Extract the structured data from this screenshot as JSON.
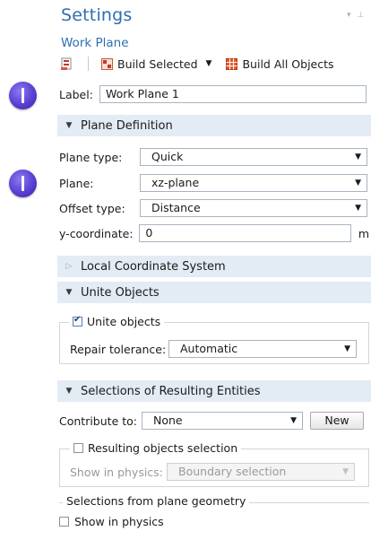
{
  "header": {
    "title": "Settings",
    "subtitle": "Work Plane",
    "pin_icon": "pin-icon"
  },
  "toolbar": {
    "build_selected_label": "Build Selected",
    "build_all_label": "Build All Objects",
    "icons": [
      "build-preceding-icon",
      "build-selected-icon",
      "build-all-icon"
    ]
  },
  "label_field": {
    "label": "Label:",
    "value": "Work Plane 1"
  },
  "plane_definition": {
    "title": "Plane Definition",
    "plane_type": {
      "label": "Plane type:",
      "value": "Quick"
    },
    "plane": {
      "label": "Plane:",
      "value": "xz-plane"
    },
    "offset_type": {
      "label": "Offset type:",
      "value": "Distance"
    },
    "coordinate": {
      "label": "y-coordinate:",
      "value": "0",
      "unit": "m"
    }
  },
  "local_coordinate_system": {
    "title": "Local Coordinate System"
  },
  "unite_objects": {
    "title": "Unite Objects",
    "checkbox_label": "Unite objects",
    "checked": true,
    "repair_label": "Repair tolerance:",
    "repair_value": "Automatic"
  },
  "selections": {
    "title": "Selections of Resulting Entities",
    "contribute_label": "Contribute to:",
    "contribute_value": "None",
    "new_button": "New",
    "resulting_label": "Resulting objects selection",
    "resulting_checked": false,
    "show_in_physics_label": "Show in physics:",
    "show_in_physics_value": "Boundary selection",
    "plane_geometry_legend": "Selections from plane geometry",
    "plane_show_label": "Show in physics",
    "plane_show_checked": false
  },
  "colors": {
    "accent": "#2f6eb1",
    "section_bg": "#e3ebf5",
    "bullet": "#5a3fd3"
  }
}
